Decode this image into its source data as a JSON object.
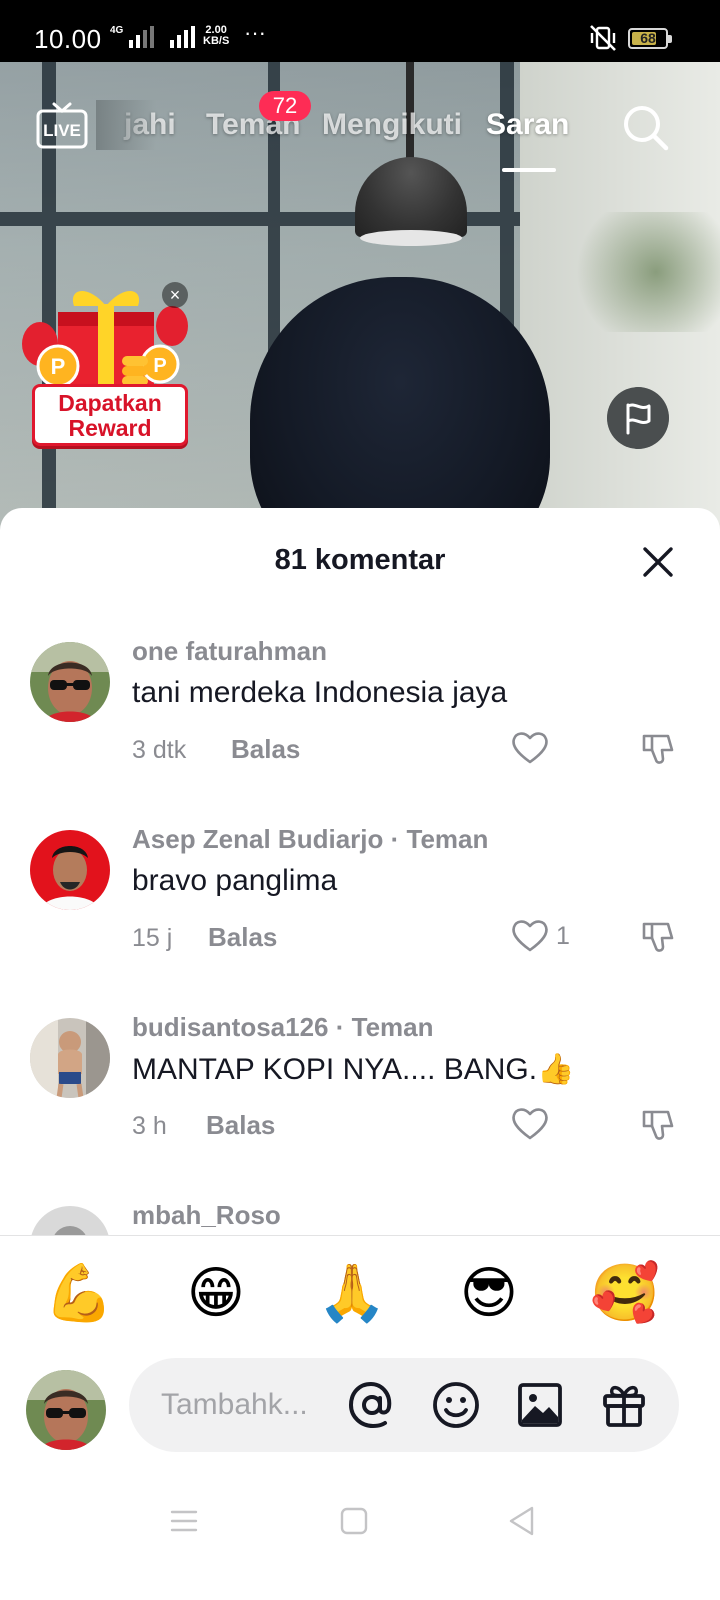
{
  "status_bar": {
    "time": "10.00",
    "network": "4G",
    "speed_value": "2.00",
    "speed_unit": "KB/S",
    "more": "···",
    "battery": "68"
  },
  "top_nav": {
    "live_label": "LIVE",
    "tabs": [
      {
        "label": "Jelajahi",
        "visible": "jahi"
      },
      {
        "label": "Teman"
      },
      {
        "label": "Mengikuti"
      },
      {
        "label": "Saran",
        "active": true
      }
    ],
    "friends_badge": "72"
  },
  "reward": {
    "label_line1": "Dapatkan",
    "label_line2": "Reward",
    "close": "×"
  },
  "comments_sheet": {
    "title": "81 komentar",
    "reply_label": "Balas",
    "comments": [
      {
        "user": "one faturahman",
        "text": "tani merdeka Indonesia jaya",
        "time": "3 dtk",
        "likes": ""
      },
      {
        "user": "Asep Zenal Budiarjo · Teman",
        "text": "bravo panglima",
        "time": "15 j",
        "likes": "1"
      },
      {
        "user": "budisantosa126 · Teman",
        "text": "MANTAP KOPI NYA.... BANG.👍",
        "time": "3 h",
        "likes": ""
      },
      {
        "user": "mbah_Roso",
        "text": "",
        "time": "",
        "likes": ""
      }
    ]
  },
  "quick_emojis": [
    "💪",
    "😁",
    "🙏",
    "😎",
    "🥰"
  ],
  "composer": {
    "placeholder": "Tambahk..."
  },
  "colors": {
    "accent": "#fe2c55",
    "reward_red": "#e0182e",
    "text_primary": "#161823",
    "text_secondary": "#8a8b91"
  }
}
